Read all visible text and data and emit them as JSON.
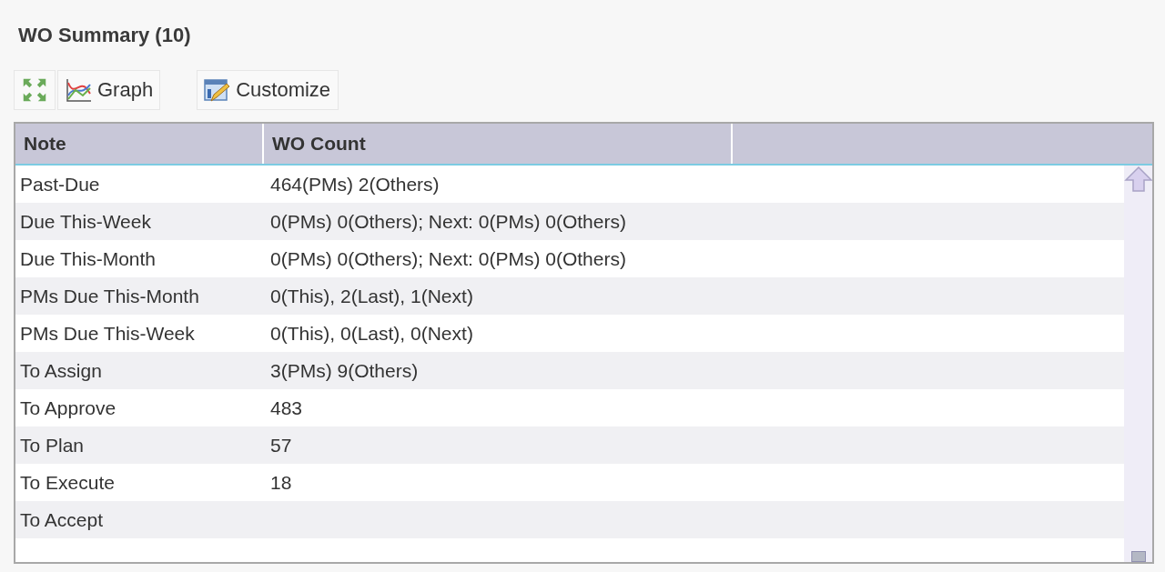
{
  "panel": {
    "title": "WO Summary (10)"
  },
  "toolbar": [
    {
      "kind": "expand"
    },
    {
      "kind": "graph",
      "label": "Graph"
    },
    {
      "kind": "customize",
      "label": "Customize"
    }
  ],
  "table": {
    "columns": [
      "Note",
      "WO Count"
    ],
    "rows": [
      [
        "Past-Due",
        "464(PMs) 2(Others)"
      ],
      [
        "Due This-Week",
        "0(PMs) 0(Others); Next: 0(PMs) 0(Others)"
      ],
      [
        "Due This-Month",
        "0(PMs) 0(Others); Next: 0(PMs) 0(Others)"
      ],
      [
        "PMs Due This-Month",
        "0(This), 2(Last), 1(Next)"
      ],
      [
        "PMs Due This-Week",
        "0(This), 0(Last), 0(Next)"
      ],
      [
        "To Assign",
        "3(PMs) 9(Others)"
      ],
      [
        "To Approve",
        "483"
      ],
      [
        "To Plan",
        "57"
      ],
      [
        "To Execute",
        "18"
      ],
      [
        "To Accept",
        ""
      ]
    ]
  }
}
